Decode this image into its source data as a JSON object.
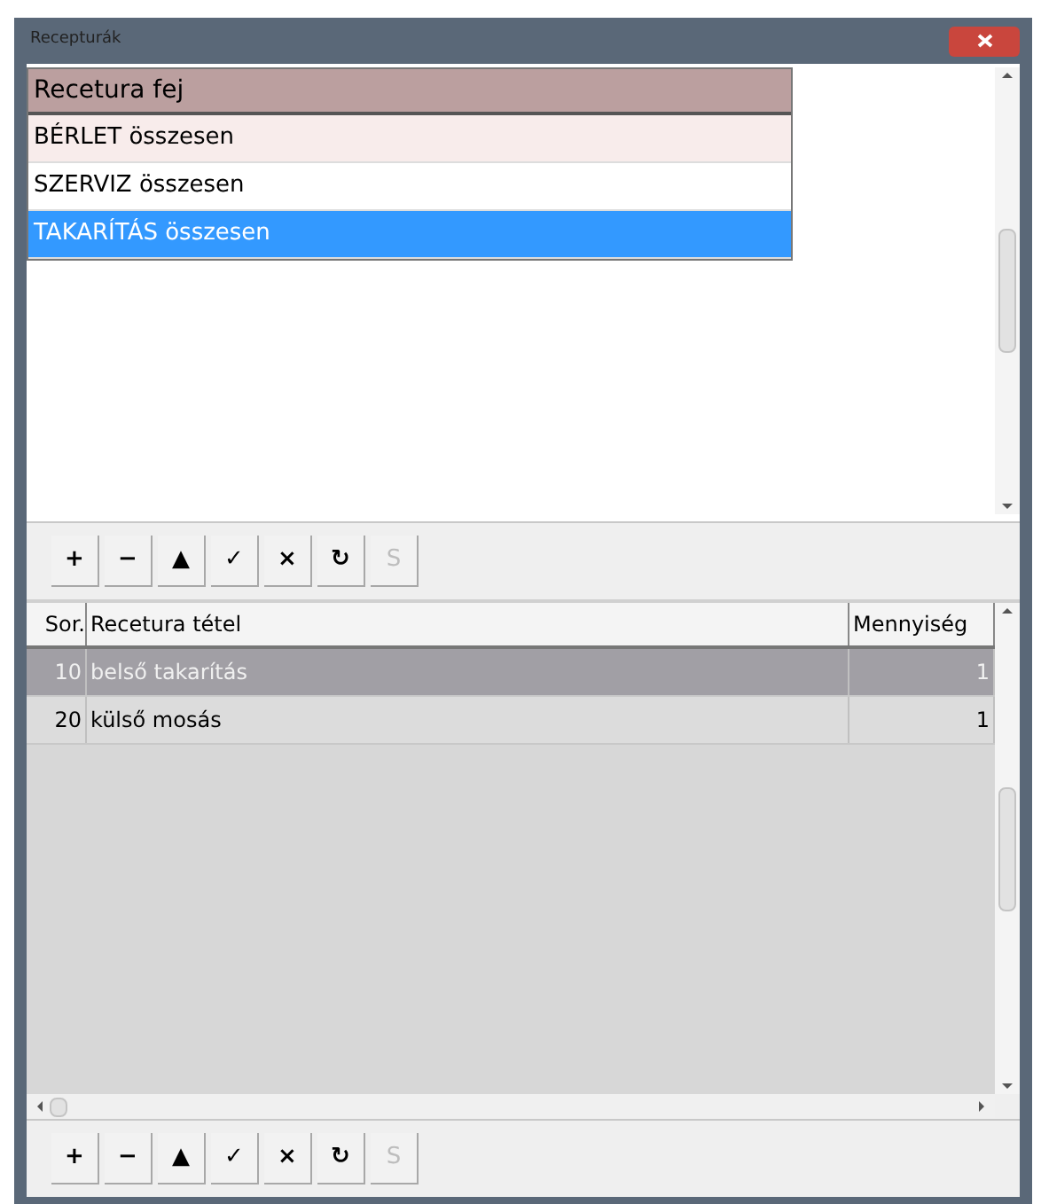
{
  "window": {
    "title": "Recepturák"
  },
  "header_list": {
    "heading": "Recetura fej",
    "items": [
      {
        "label": "BÉRLET összesen",
        "selected": false,
        "shade": true
      },
      {
        "label": "SZERVIZ összesen",
        "selected": false,
        "shade": false
      },
      {
        "label": "TAKARÍTÁS összesen",
        "selected": true,
        "shade": false
      }
    ]
  },
  "toolbar_top": [
    {
      "label": "+",
      "disabled": false
    },
    {
      "label": "−",
      "disabled": false
    },
    {
      "label": "▲",
      "disabled": false
    },
    {
      "label": "✓",
      "disabled": false
    },
    {
      "label": "×",
      "disabled": false
    },
    {
      "label": "↻",
      "disabled": false
    },
    {
      "label": "S",
      "disabled": true
    }
  ],
  "items_table": {
    "columns": [
      "Sor.",
      "Recetura tétel",
      "Mennyiség"
    ],
    "rows": [
      {
        "cells": [
          "10",
          "belső takarítás",
          "1"
        ],
        "selected": true
      },
      {
        "cells": [
          "20",
          "külső mosás",
          "1"
        ],
        "selected": false
      }
    ]
  },
  "toolbar_bottom": [
    {
      "label": "+",
      "disabled": false
    },
    {
      "label": "−",
      "disabled": false
    },
    {
      "label": "▲",
      "disabled": false
    },
    {
      "label": "✓",
      "disabled": false
    },
    {
      "label": "×",
      "disabled": false
    },
    {
      "label": "↻",
      "disabled": false
    },
    {
      "label": "S",
      "disabled": true
    }
  ]
}
